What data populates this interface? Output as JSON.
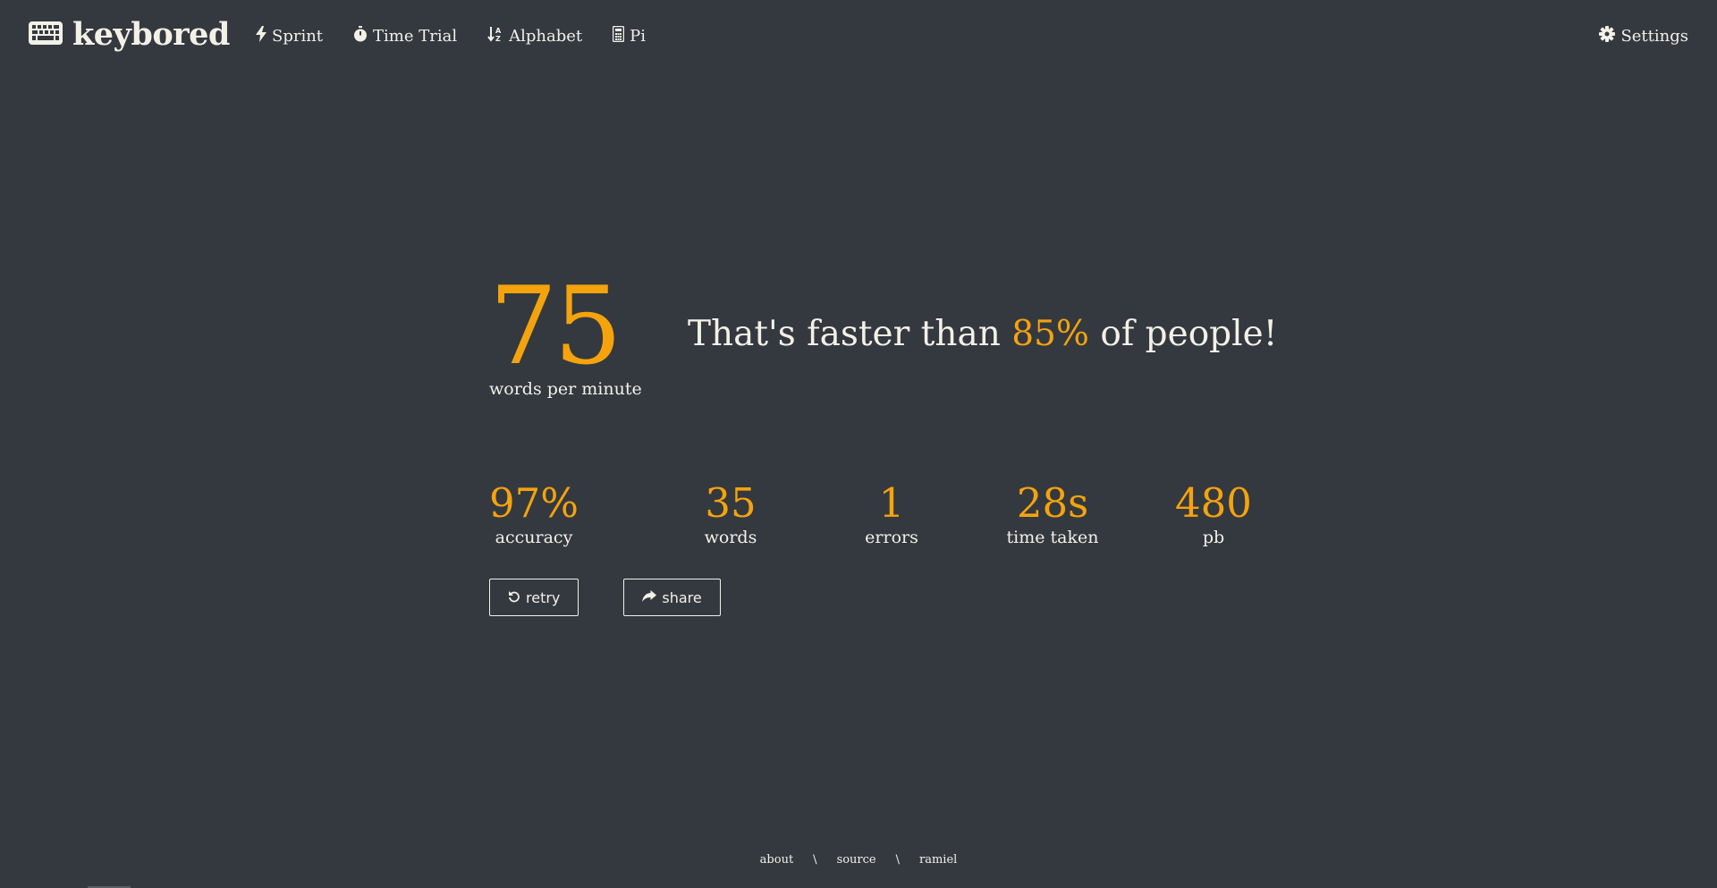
{
  "app": {
    "name": "keybored"
  },
  "nav": {
    "items": [
      {
        "label": "Sprint",
        "icon": "bolt-icon"
      },
      {
        "label": "Time Trial",
        "icon": "stopwatch-icon"
      },
      {
        "label": "Alphabet",
        "icon": "sort-alpha-icon"
      },
      {
        "label": "Pi",
        "icon": "calculator-icon"
      }
    ],
    "settings_label": "Settings"
  },
  "result": {
    "wpm": "75",
    "wpm_label": "words per minute",
    "faster_prefix": "That's faster than ",
    "faster_percent": "85%",
    "faster_suffix": " of people!"
  },
  "stats": [
    {
      "value": "97%",
      "label": "accuracy"
    },
    {
      "value": "35",
      "label": "words"
    },
    {
      "value": "1",
      "label": "errors"
    },
    {
      "value": "28s",
      "label": "time taken"
    },
    {
      "value": "480",
      "label": "pb"
    }
  ],
  "actions": {
    "retry_label": "retry",
    "share_label": "share"
  },
  "footer": {
    "links": [
      "about",
      "source",
      "ramiel"
    ],
    "separator": "\\"
  },
  "colors": {
    "background": "#343940",
    "accent": "#f5a30d",
    "text": "#f3f0e6"
  }
}
